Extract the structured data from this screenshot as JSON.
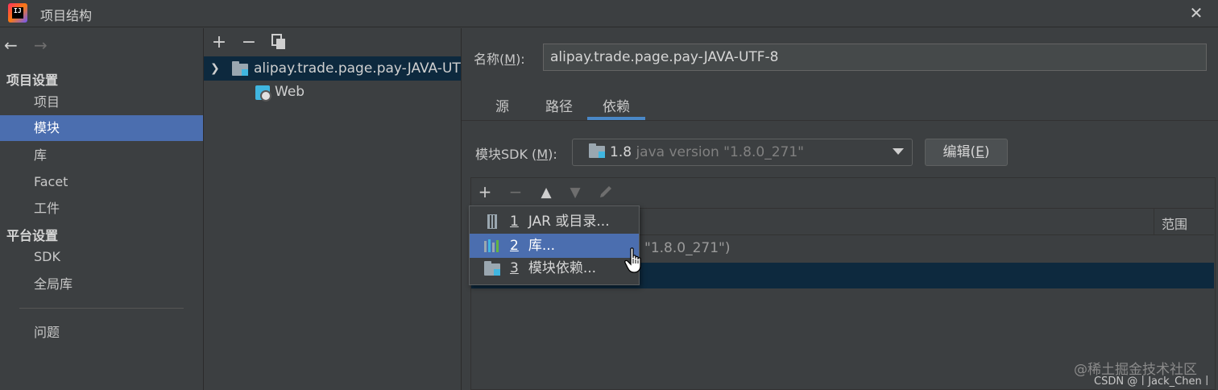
{
  "window": {
    "title": "项目结构",
    "app_icon": "intellij-idea-icon",
    "close_icon": "close-icon"
  },
  "sidebar": {
    "back_icon": "arrow-left-icon",
    "forward_icon": "arrow-right-icon",
    "project_settings_header": "项目设置",
    "items_project": [
      "项目",
      "模块",
      "库",
      "Facet",
      "工件"
    ],
    "platform_settings_header": "平台设置",
    "items_platform": [
      "SDK",
      "全局库"
    ],
    "problems": "问题",
    "selected": "模块"
  },
  "tree": {
    "toolbar": {
      "add": "+",
      "remove": "−",
      "copy_icon": "copy-icon"
    },
    "module_name": "alipay.trade.page.pay-JAVA-UTF-8",
    "facet": "Web"
  },
  "details": {
    "name_label_prefix": "名称(",
    "name_label_mnemonic": "M",
    "name_label_suffix": "):",
    "name_value": "alipay.trade.page.pay-JAVA-UTF-8",
    "tabs": [
      "源",
      "路径",
      "依赖"
    ],
    "active_tab": "依赖",
    "sdk_label_prefix": "模块SDK (",
    "sdk_label_mnemonic": "M",
    "sdk_label_suffix": "):",
    "sdk_value": "1.8",
    "sdk_detail": "java version \"1.8.0_271\"",
    "edit_prefix": "编辑(",
    "edit_mnemonic": "E",
    "edit_suffix": ")"
  },
  "dependencies": {
    "toolbar": {
      "add": "+",
      "remove": "−",
      "up": "▲",
      "down": "▼",
      "edit_icon": "pencil-icon"
    },
    "scope_header": "范围",
    "row_partial": "\"1.8.0_271\")"
  },
  "popup_menu": {
    "items": [
      {
        "mnemonic": "1",
        "label": "JAR 或目录..."
      },
      {
        "mnemonic": "2",
        "label": "库..."
      },
      {
        "mnemonic": "3",
        "label": "模块依赖..."
      }
    ],
    "highlighted_index": 1
  },
  "watermark": {
    "line1": "@稀土掘金技术社区",
    "line2": "CSDN @丨Jack_Chen丨"
  },
  "colors": {
    "background": "#3c3f41",
    "selection": "#4b6eaf",
    "tree_selection": "#0d293e",
    "tab_underline": "#4a88c7"
  }
}
